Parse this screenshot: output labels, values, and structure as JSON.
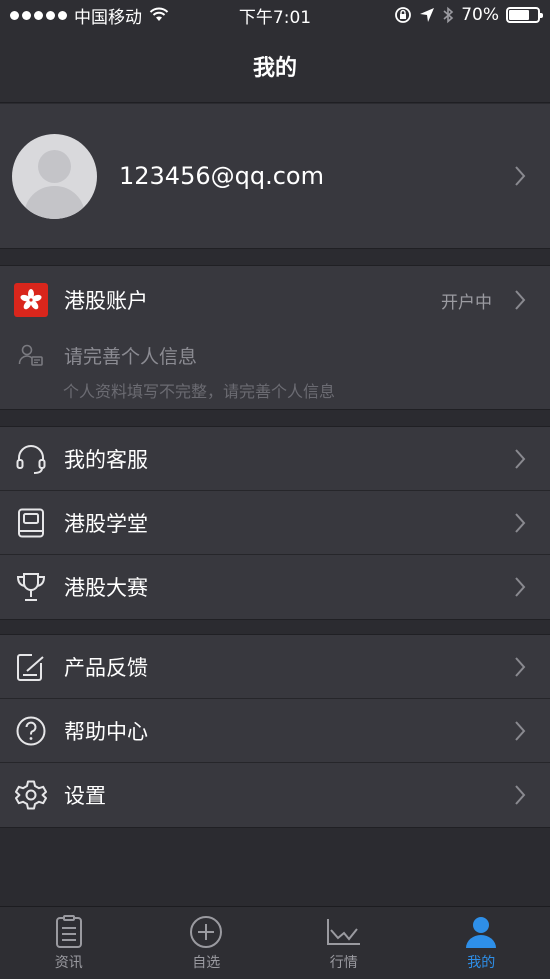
{
  "status_bar": {
    "carrier": "中国移动",
    "time": "下午7:01",
    "battery_text": "70%",
    "battery_level": 0.7
  },
  "nav": {
    "title": "我的"
  },
  "profile": {
    "email": "123456@qq.com"
  },
  "hk_account": {
    "label": "港股账户",
    "status": "开户中",
    "info_title": "请完善个人信息",
    "info_desc": "个人资料填写不完整，请完善个人信息"
  },
  "group1": [
    {
      "label": "我的客服",
      "icon": "headset-icon"
    },
    {
      "label": "港股学堂",
      "icon": "book-icon"
    },
    {
      "label": "港股大赛",
      "icon": "trophy-icon"
    }
  ],
  "group2": [
    {
      "label": "产品反馈",
      "icon": "feedback-icon"
    },
    {
      "label": "帮助中心",
      "icon": "question-icon"
    },
    {
      "label": "设置",
      "icon": "gear-icon"
    }
  ],
  "tabs": [
    {
      "label": "资讯",
      "icon": "news-icon",
      "active": false
    },
    {
      "label": "自选",
      "icon": "plus-circle-icon",
      "active": false
    },
    {
      "label": "行情",
      "icon": "chart-icon",
      "active": false
    },
    {
      "label": "我的",
      "icon": "user-icon",
      "active": true
    }
  ],
  "colors": {
    "background": "#2b2b30",
    "card": "#38383e",
    "accent": "#2e8fe8",
    "hk_red": "#d9261c"
  }
}
